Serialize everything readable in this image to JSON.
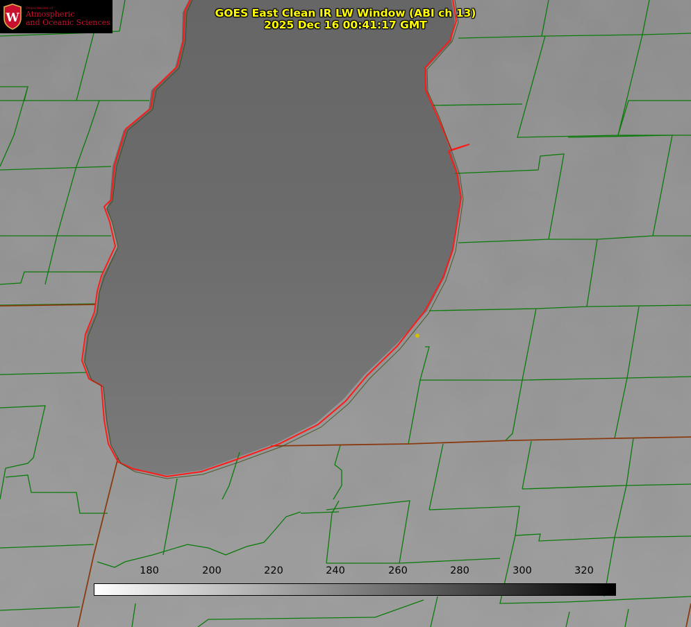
{
  "logo": {
    "dept_text": "Department of",
    "line1": "Atmospheric",
    "line2": "and Oceanic Sciences",
    "crest_letter": "W",
    "icon": "uw-crest-icon",
    "color": "#c8102e"
  },
  "title": {
    "line1": "GOES East Clean IR LW Window (ABI ch 13)",
    "line2": "2025 Dec 16 00:41:17 GMT",
    "color": "#ffff00"
  },
  "colorbar": {
    "ticks": [
      "180",
      "200",
      "220",
      "240",
      "260",
      "280",
      "300",
      "320"
    ],
    "gradient_start": "#ffffff",
    "gradient_end": "#000000"
  },
  "map": {
    "county_line_color": "#0a7a0a",
    "state_line_color": "#8a3a10",
    "coastline_color": "#ff1a1a",
    "marker_color": "#d4c000",
    "lake_color": "#6a6a6a",
    "land_color": "#8e8e8e"
  }
}
